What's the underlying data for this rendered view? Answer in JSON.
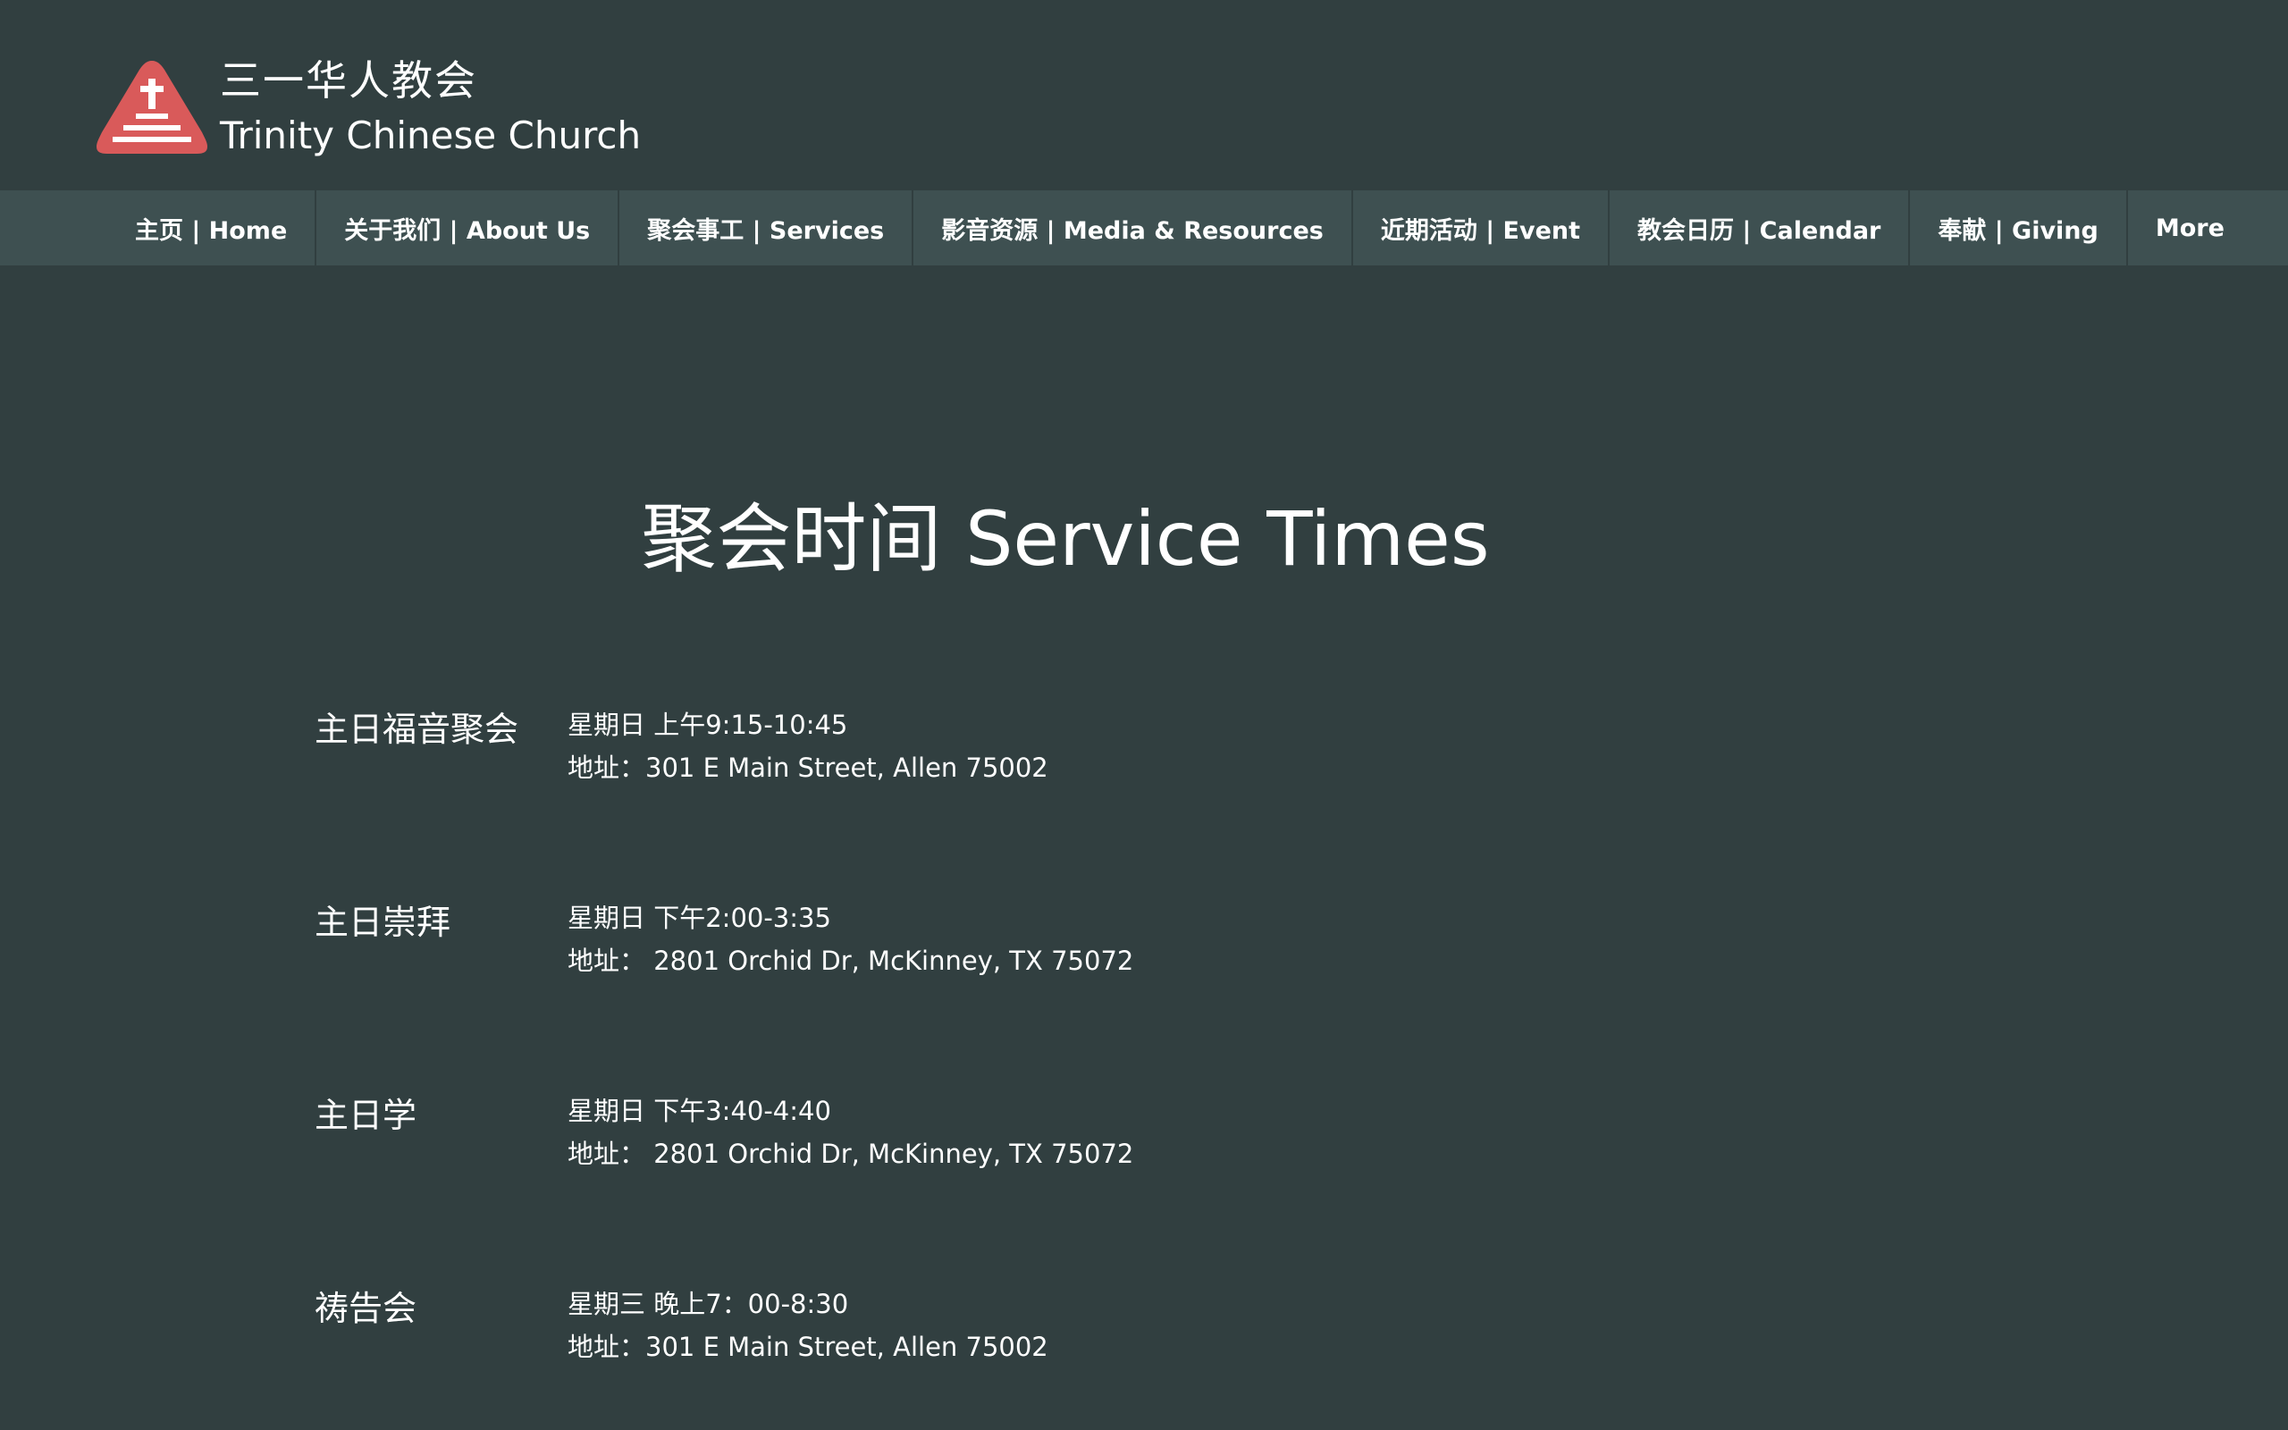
{
  "brand": {
    "name_cn": "三一华人教会",
    "name_en": "Trinity Chinese Church",
    "logo_icon": "church-steps-cross-icon",
    "logo_color": "#d95a5a"
  },
  "nav": {
    "items": [
      {
        "label": "主页 | Home"
      },
      {
        "label": "关于我们 | About Us"
      },
      {
        "label": "聚会事工 | Services"
      },
      {
        "label": "影音资源 | Media & Resources"
      },
      {
        "label": "近期活动 | Event"
      },
      {
        "label": "教会日历 | Calendar"
      },
      {
        "label": "奉献 | Giving"
      },
      {
        "label": "More"
      }
    ]
  },
  "main": {
    "title": "聚会时间 Service Times",
    "services": [
      {
        "name": "主日福音聚会",
        "time": "星期日 上午9:15-10:45",
        "address": "地址：301 E Main Street, Allen 75002"
      },
      {
        "name": "主日崇拜",
        "time": "星期日 下午2:00-3:35",
        "address": "地址：  2801 Orchid Dr, McKinney, TX 75072"
      },
      {
        "name": "主日学",
        "time": "星期日 下午3:40-4:40",
        "address": "地址：  2801 Orchid Dr, McKinney, TX 75072"
      },
      {
        "name": "祷告会",
        "time": "星期三 晚上7：00-8:30",
        "address": "地址：301 E Main Street, Allen 75002"
      }
    ]
  },
  "colors": {
    "background": "#313f40",
    "nav_background": "#3e5051",
    "text": "#ffffff"
  }
}
